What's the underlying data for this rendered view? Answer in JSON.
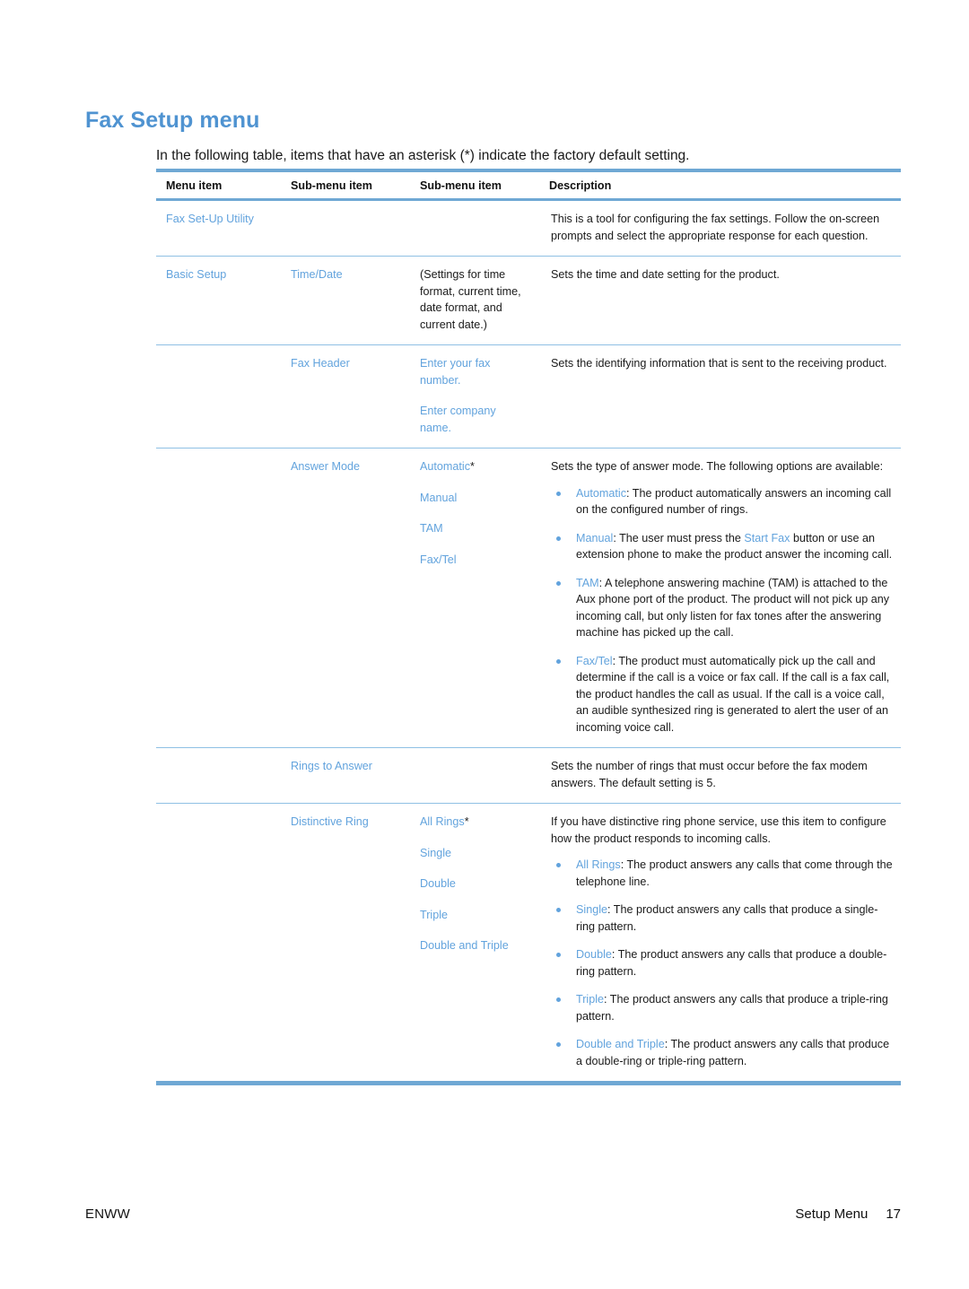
{
  "document": {
    "title": "Fax Setup menu",
    "intro": "In the following table, items that have an asterisk (*) indicate the factory default setting."
  },
  "theme": {
    "accent_blue": "#6FA8D4",
    "link_blue": "#62A3DD",
    "heading_blue": "#4F93D1",
    "text_black": "#1a1a1a"
  },
  "table": {
    "headers": {
      "menu_item": "Menu item",
      "sub_menu_item_1": "Sub-menu item",
      "sub_menu_item_2": "Sub-menu item",
      "description": "Description"
    },
    "rows": [
      {
        "menu_item": "Fax Set-Up Utility",
        "sub1": "",
        "sub2_list": [],
        "desc": "This is a tool for configuring the fax settings. Follow the on-screen prompts and select the appropriate response for each question.",
        "bullets": []
      },
      {
        "menu_item": "Basic Setup",
        "sub1": "Time/Date",
        "sub2_list": [
          "(Settings for time format, current time, date format, and current date.)"
        ],
        "desc": "Sets the time and date setting for the product.",
        "bullets": []
      },
      {
        "menu_item": "",
        "sub1": "Fax Header",
        "sub2_list": [
          "Enter your fax number.",
          "Enter company name."
        ],
        "desc": "Sets the identifying information that is sent to the receiving product.",
        "bullets": []
      },
      {
        "menu_item": "",
        "sub1": "Answer Mode",
        "sub2_list": [
          "Automatic*",
          "Manual",
          "TAM",
          "Fax/Tel"
        ],
        "desc": "Sets the type of answer mode. The following options are available:",
        "bullets": [
          {
            "term": "Automatic",
            "text": ": The product automatically answers an incoming call on the configured number of rings."
          },
          {
            "term": "Manual",
            "text": ": The user must press the ",
            "inline_term": "Start Fax",
            "text2": " button or use an extension phone to make the product answer the incoming call."
          },
          {
            "term": "TAM",
            "text": ": A telephone answering machine (TAM) is attached to the Aux phone port of the product. The product will not pick up any incoming call, but only listen for fax tones after the answering machine has picked up the call."
          },
          {
            "term": "Fax/Tel",
            "text": ": The product must automatically pick up the call and determine if the call is a voice or fax call. If the call is a fax call, the product handles the call as usual. If the call is a voice call, an audible synthesized ring is generated to alert the user of an incoming voice call."
          }
        ]
      },
      {
        "menu_item": "",
        "sub1": "Rings to Answer",
        "sub2_list": [],
        "desc": "Sets the number of rings that must occur before the fax modem answers. The default setting is 5.",
        "bullets": []
      },
      {
        "menu_item": "",
        "sub1": "Distinctive Ring",
        "sub2_list": [
          "All Rings*",
          "Single",
          "Double",
          "Triple",
          "Double and Triple"
        ],
        "desc": "If you have distinctive ring phone service, use this item to configure how the product responds to incoming calls.",
        "bullets": [
          {
            "term": "All Rings",
            "text": ": The product answers any calls that come through the telephone line."
          },
          {
            "term": "Single",
            "text": ": The product answers any calls that produce a single-ring pattern."
          },
          {
            "term": "Double",
            "text": ": The product answers any calls that produce a double-ring pattern."
          },
          {
            "term": "Triple",
            "text": ": The product answers any calls that produce a triple-ring pattern."
          },
          {
            "term": "Double and Triple",
            "text": ": The product answers any calls that produce a double-ring or triple-ring pattern."
          }
        ]
      }
    ]
  },
  "footer": {
    "left": "ENWW",
    "section": "Setup Menu",
    "page_number": "17"
  }
}
